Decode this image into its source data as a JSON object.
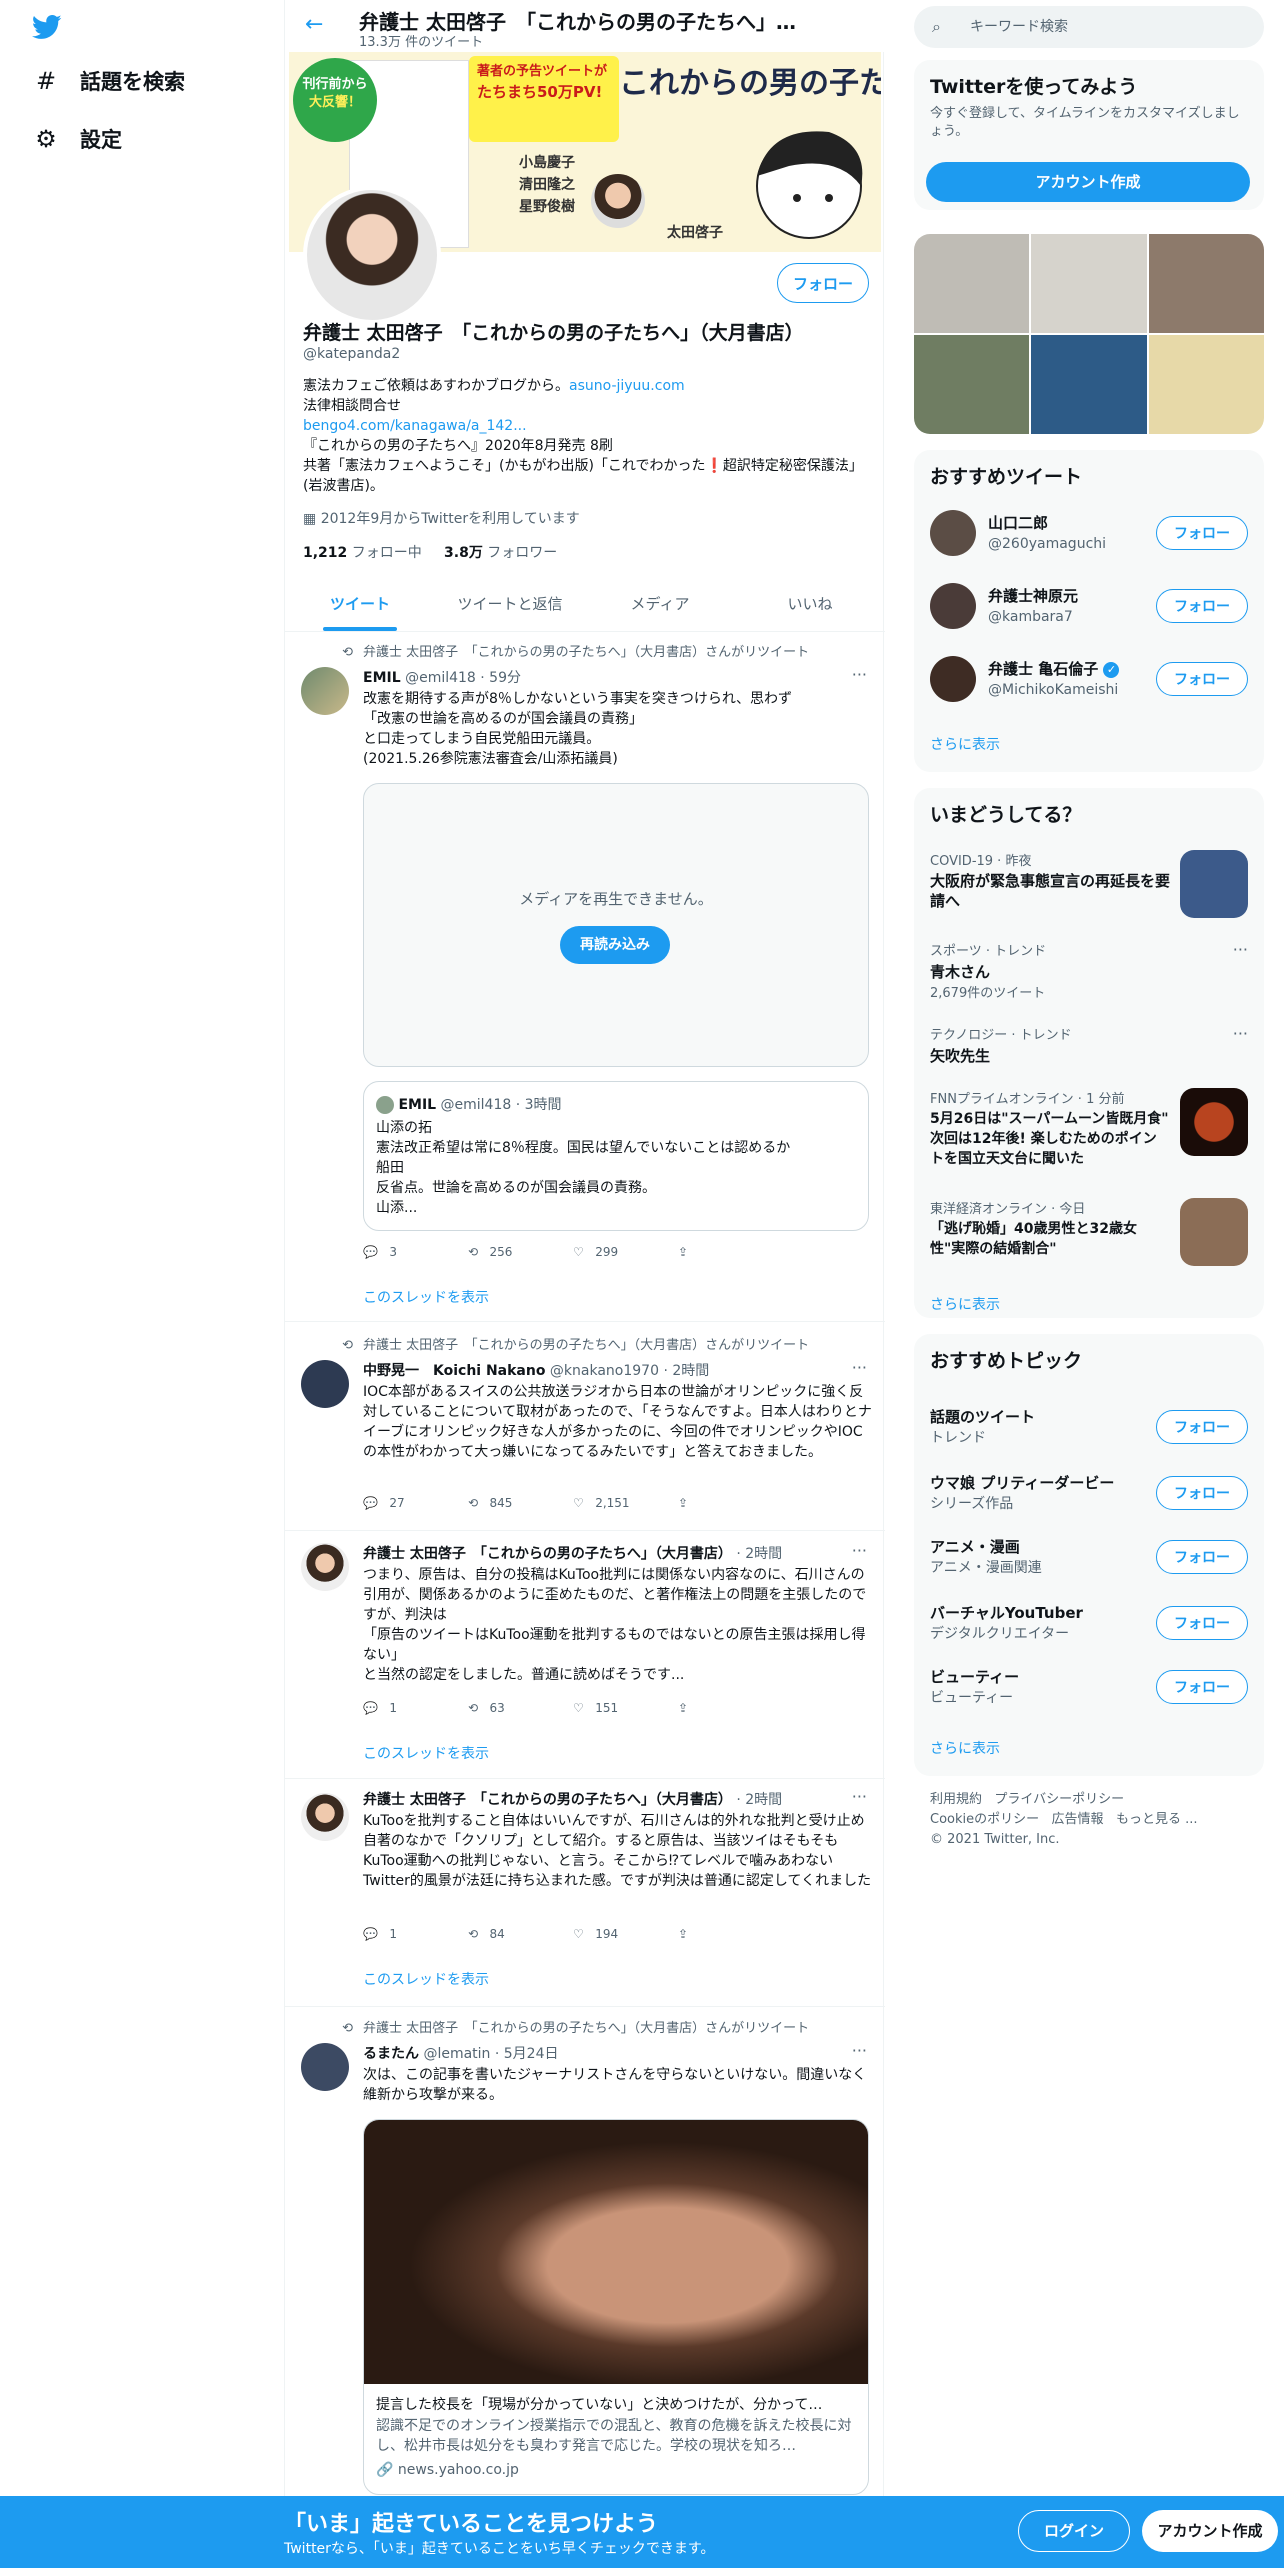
{
  "nav": {
    "search_label": "話題を検索",
    "settings_label": "設定"
  },
  "topbar": {
    "name": "弁護士 太田啓子　「これからの男の子たちへ」…",
    "count": "13.3万 件のツイート"
  },
  "banner": {
    "badge_line1": "刊行前から",
    "badge_line2": "大反響！",
    "yellow_heading": "著者の予告ツイートが",
    "yellow_heading2": "たちまち50万PV!",
    "big_title": "これからの男の子たちへ",
    "names": [
      "小島慶子",
      "清田隆之",
      "星野俊樹",
      "太田啓子"
    ]
  },
  "profile": {
    "follow_label": "フォロー",
    "name": "弁護士 太田啓子　「これからの男の子たちへ」（大月書店）",
    "handle": "@katepanda2",
    "bio1": "憲法カフェご依頼はあすわかブログから。",
    "bio1_link": "asuno-jiyuu.com",
    "bio2": "法律相談問合せ",
    "bio3_link": "bengo4.com/kanagawa/a_142...",
    "bio4": "『これからの男の子たちへ』2020年8月発売 8刷",
    "bio5": "共著「憲法カフェへようこそ」(かもがわ出版)「これでわかった❗超訳特定秘密保護法」(岩波書店)。",
    "joined": "2012年9月からTwitterを利用しています",
    "following_num": "1,212",
    "following_label": "フォロー中",
    "followers_num": "3.8万",
    "followers_label": "フォロワー"
  },
  "tabs": [
    "ツイート",
    "ツイートと返信",
    "メディア",
    "いいね"
  ],
  "tweets": [
    {
      "rt": "弁護士 太田啓子　「これからの男の子たちへ」（大月書店）さんがリツイート",
      "name": "EMIL",
      "handle": "@emil418 · 59分",
      "text": "改憲を期待する声が8％しかないという事実を突きつけられ、思わず\n「改憲の世論を高めるのが国会議員の責務」\nと口走ってしまう自民党船田元議員。\n(2021.5.26参院憲法審査会/山添拓議員)",
      "media_msg": "メディアを再生できません。",
      "reload": "再読み込み",
      "quote_name": "EMIL",
      "quote_handle": "@emil418 · 3時間",
      "quote_text": "山添の拓\n憲法改正希望は常に8％程度。国民は望んでいないことは認めるか\n船田\n反省点。世論を高めるのが国会議員の責務。\n山添...",
      "replies": "3",
      "retweets": "256",
      "likes": "299",
      "thread": "このスレッドを表示"
    },
    {
      "rt": "弁護士 太田啓子　「これからの男の子たちへ」（大月書店）さんがリツイート",
      "name": "中野晃一　Koichi Nakano",
      "handle": "@knakano1970 · 2時間",
      "text": "IOC本部があるスイスの公共放送ラジオから日本の世論がオリンピックに強く反対していることについて取材があったので、「そうなんですよ。日本人はわりとナイーブにオリンピック好きな人が多かったのに、今回の件でオリンピックやIOCの本性がわかって大っ嫌いになってるみたいです」と答えておきました。",
      "replies": "27",
      "retweets": "845",
      "likes": "2,151"
    },
    {
      "name": "弁護士 太田啓子　「これからの男の子たちへ」（大月書店）",
      "handle": "· 2時間",
      "text": "つまり、原告は、自分の投稿はKuToo批判には関係ない内容なのに、石川さんの引用が、関係あるかのように歪めたものだ、と著作権法上の問題を主張したのですが、判決は\n「原告のツイートはKuToo運動を批判するものではないとの原告主張は採用し得ない」\nと当然の認定をしました。普通に読めばそうです...",
      "replies": "1",
      "retweets": "63",
      "likes": "151",
      "thread": "このスレッドを表示"
    },
    {
      "name": "弁護士 太田啓子　「これからの男の子たちへ」（大月書店）",
      "handle": "· 2時間",
      "text": "KuTooを批判すること自体はいいんですが、石川さんは的外れな批判と受け止め自著のなかで「クソリプ」として紹介。すると原告は、当該ツイはそもそもKuToo運動への批判じゃない、と言う。そこから⁉てレベルで噛みあわないTwitter的風景が法廷に持ち込まれた感。ですが判決は普通に認定してくれました",
      "replies": "1",
      "retweets": "84",
      "likes": "194",
      "thread": "このスレッドを表示"
    },
    {
      "rt": "弁護士 太田啓子　「これからの男の子たちへ」（大月書店）さんがリツイート",
      "name": "るまたん",
      "handle": "@lematin · 5月24日",
      "text": "次は、この記事を書いたジャーナリストさんを守らないといけない。間違いなく維新から攻撃が来る。",
      "card_title": "提言した校長を「現場が分かっていない」と決めつけたが、分かって…",
      "card_desc": "認識不足でのオンライン授業指示での混乱と、教育の危機を訴えた校長に対し、松井市長は処分をも臭わす発言で応じた。学校の現状を知ろ…",
      "card_domain": "news.yahoo.co.jp"
    }
  ],
  "right": {
    "search_placeholder": "キーワード検索",
    "signup": {
      "title": "Twitterを使ってみよう",
      "desc": "今すぐ登録して、タイムラインをカスタマイズしましょう。",
      "button": "アカウント作成"
    },
    "who_title": "おすすめツイート",
    "who": [
      {
        "name": "山口二郎",
        "handle": "@260yamaguchi",
        "follow": "フォロー"
      },
      {
        "name": "弁護士神原元",
        "handle": "@kambara7",
        "follow": "フォロー"
      },
      {
        "name": "弁護士 亀石倫子",
        "handle": "@MichikoKameishi",
        "follow": "フォロー"
      }
    ],
    "show_more": "さらに表示",
    "trends_title": "いまどうしてる？",
    "trends": [
      {
        "meta": "COVID-19 · 昨夜",
        "title": "大阪府が緊急事態宣言の再延長を要請へ"
      },
      {
        "meta": "スポーツ · トレンド",
        "title": "青木さん",
        "count": "2,679件のツイート"
      },
      {
        "meta": "テクノロジー · トレンド",
        "title": "矢吹先生"
      },
      {
        "meta": "FNNプライムオンライン · 1 分前",
        "title": "5月26日は\"スーパームーン皆既月食\" 次回は12年後! 楽しむためのポイントを国立天文台に聞いた"
      },
      {
        "meta": "東洋経済オンライン · 今日",
        "title": "「逃げ恥婚」40歳男性と32歳女性\"実際の結婚割合\""
      }
    ],
    "topics_title": "おすすめトピック",
    "topics": [
      {
        "name": "話題のツイート",
        "cat": "トレンド"
      },
      {
        "name": "ウマ娘 プリティーダービー",
        "cat": "シリーズ作品"
      },
      {
        "name": "アニメ・漫画",
        "cat": "アニメ・漫画関連"
      },
      {
        "name": "バーチャルYouTuber",
        "cat": "デジタルクリエイター"
      },
      {
        "name": "ビューティー",
        "cat": "ビューティー"
      }
    ],
    "footer_links": [
      "利用規約",
      "プライバシーポリシー",
      "Cookieのポリシー",
      "広告情報",
      "もっと見る ...",
      "© 2021 Twitter, Inc."
    ]
  },
  "bottom": {
    "title": "「いま」起きていることを見つけよう",
    "sub": "Twitterなら、「いま」起きていることをいち早くチェックできます。",
    "login": "ログイン",
    "signup": "アカウント作成"
  }
}
